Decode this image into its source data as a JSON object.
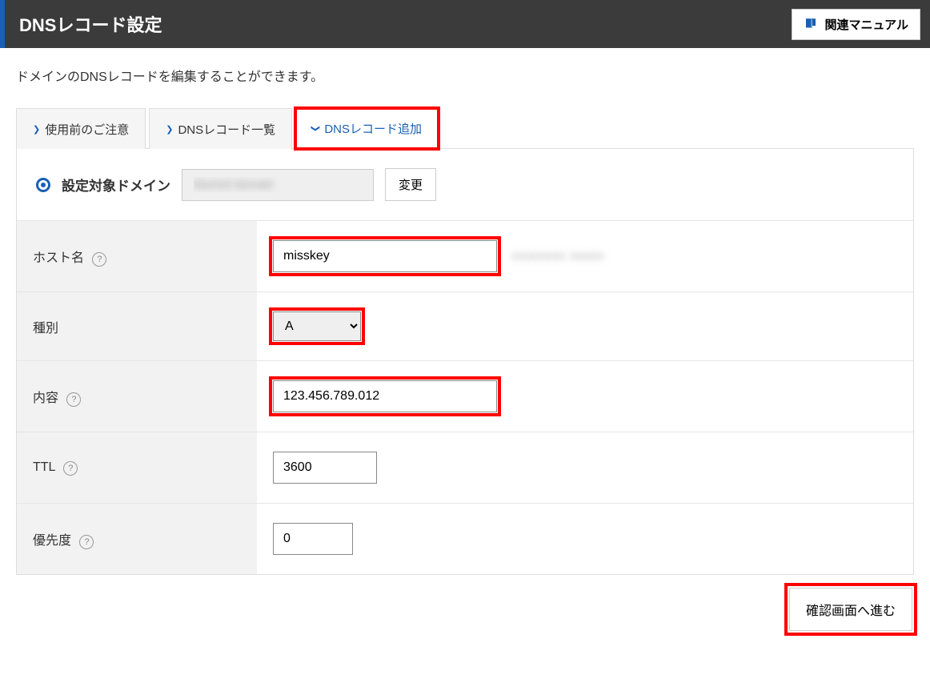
{
  "header": {
    "title": "DNSレコード設定",
    "manual_button": "関連マニュアル"
  },
  "description": "ドメインのDNSレコードを編集することができます。",
  "tabs": [
    {
      "label": "使用前のご注意",
      "active": false
    },
    {
      "label": "DNSレコード一覧",
      "active": false
    },
    {
      "label": "DNSレコード追加",
      "active": true
    }
  ],
  "domain_section": {
    "label": "設定対象ドメイン",
    "change_button": "変更"
  },
  "form": {
    "hostname": {
      "label": "ホスト名",
      "value": "misskey"
    },
    "type": {
      "label": "種別",
      "value": "A"
    },
    "content": {
      "label": "内容",
      "value": "123.456.789.012"
    },
    "ttl": {
      "label": "TTL",
      "value": "3600"
    },
    "priority": {
      "label": "優先度",
      "value": "0"
    }
  },
  "confirm_button": "確認画面へ進む",
  "help_symbol": "?"
}
